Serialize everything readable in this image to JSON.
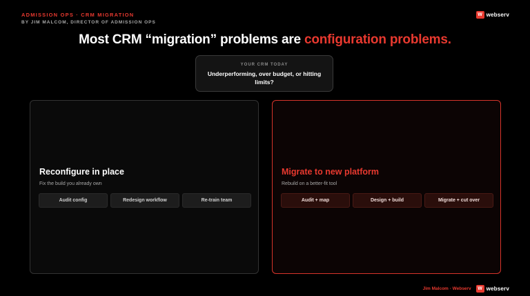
{
  "header": {
    "eyebrow": "ADMISSION OPS · CRM MIGRATION",
    "byline": "BY JIM MALCOM, DIRECTOR OF ADMISSION OPS",
    "brand_mark": "W",
    "brand_name": "webserv"
  },
  "headline": {
    "main": "Most CRM “migration” problems are ",
    "accent": "configuration problems."
  },
  "crm_box": {
    "label": "YOUR CRM TODAY",
    "text": "Underperforming, over budget, or hitting limits?"
  },
  "options": [
    {
      "title": "Reconfigure in place",
      "subtitle": "Fix the build you already own",
      "steps": [
        "Audit config",
        "Redesign workflow",
        "Re-train team"
      ]
    },
    {
      "title": "Migrate to new platform",
      "subtitle": "Rebuild on a better-fit tool",
      "steps": [
        "Audit + map",
        "Design + build",
        "Migrate + cut over"
      ]
    }
  ],
  "footer": {
    "author": "Jim Malcom · Webserv",
    "brand_mark": "W",
    "brand_name": "webserv"
  },
  "colors": {
    "accent": "#e8392f",
    "background": "#000000",
    "panel_border_left": "#333333",
    "panel_border_right": "#d8342b"
  }
}
